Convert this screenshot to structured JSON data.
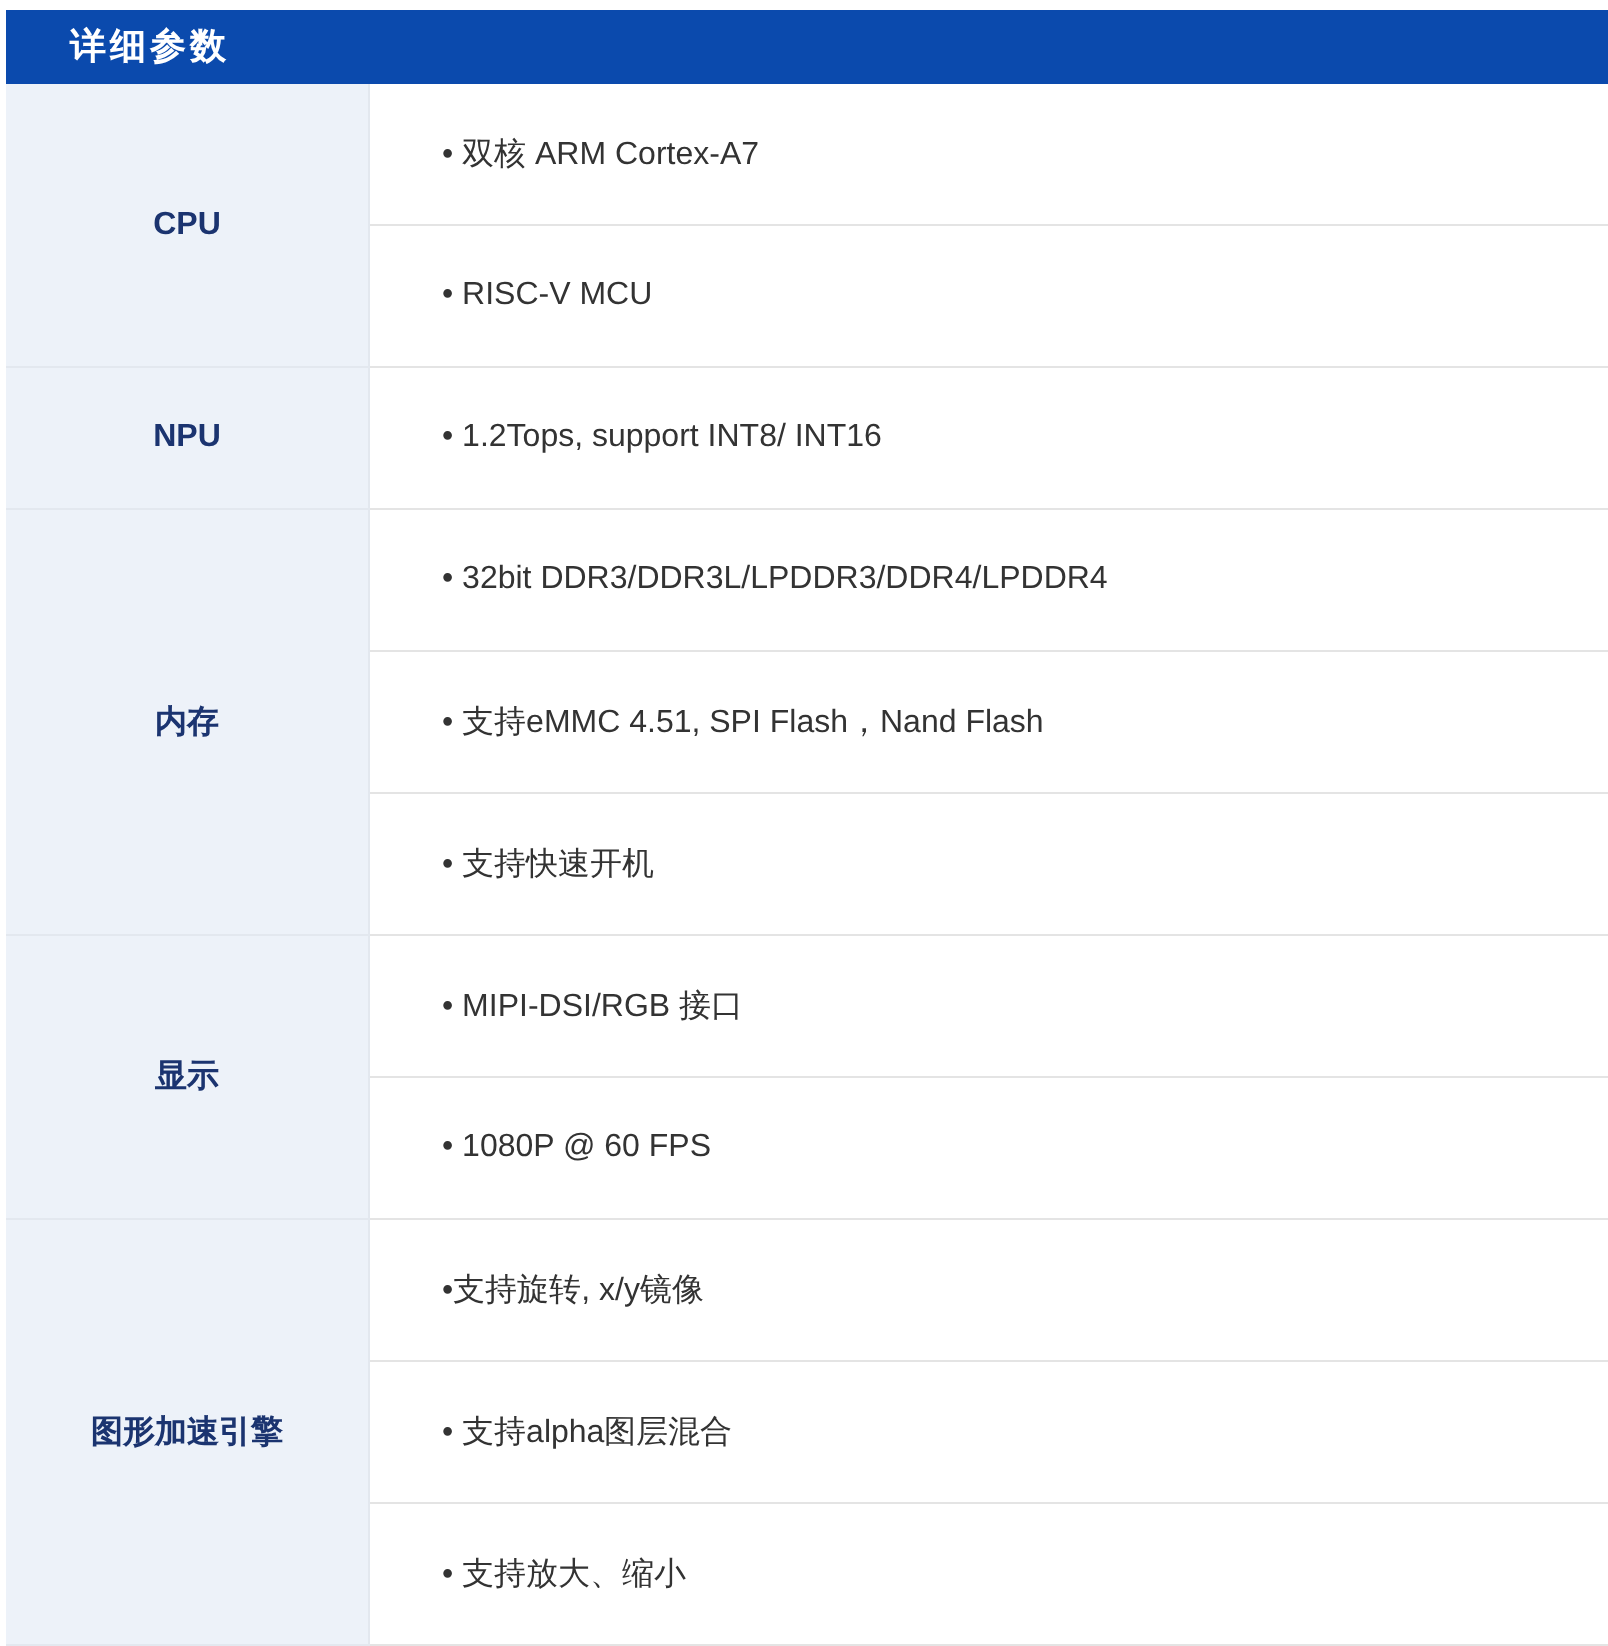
{
  "title": "详细参数",
  "groups": [
    {
      "label": "CPU",
      "items": [
        "• 双核 ARM Cortex-A7",
        "• RISC-V MCU"
      ]
    },
    {
      "label": "NPU",
      "items": [
        "• 1.2Tops, support INT8/ INT16"
      ]
    },
    {
      "label": "内存",
      "items": [
        "• 32bit DDR3/DDR3L/LPDDR3/DDR4/LPDDR4",
        "• 支持eMMC 4.51, SPI Flash，Nand Flash",
        "• 支持快速开机"
      ]
    },
    {
      "label": "显示",
      "items": [
        "• MIPI-DSI/RGB 接口",
        "• 1080P @ 60 FPS"
      ]
    },
    {
      "label": "图形加速引擎",
      "items": [
        "•支持旋转, x/y镜像",
        "• 支持alpha图层混合",
        "• 支持放大、缩小"
      ]
    }
  ]
}
